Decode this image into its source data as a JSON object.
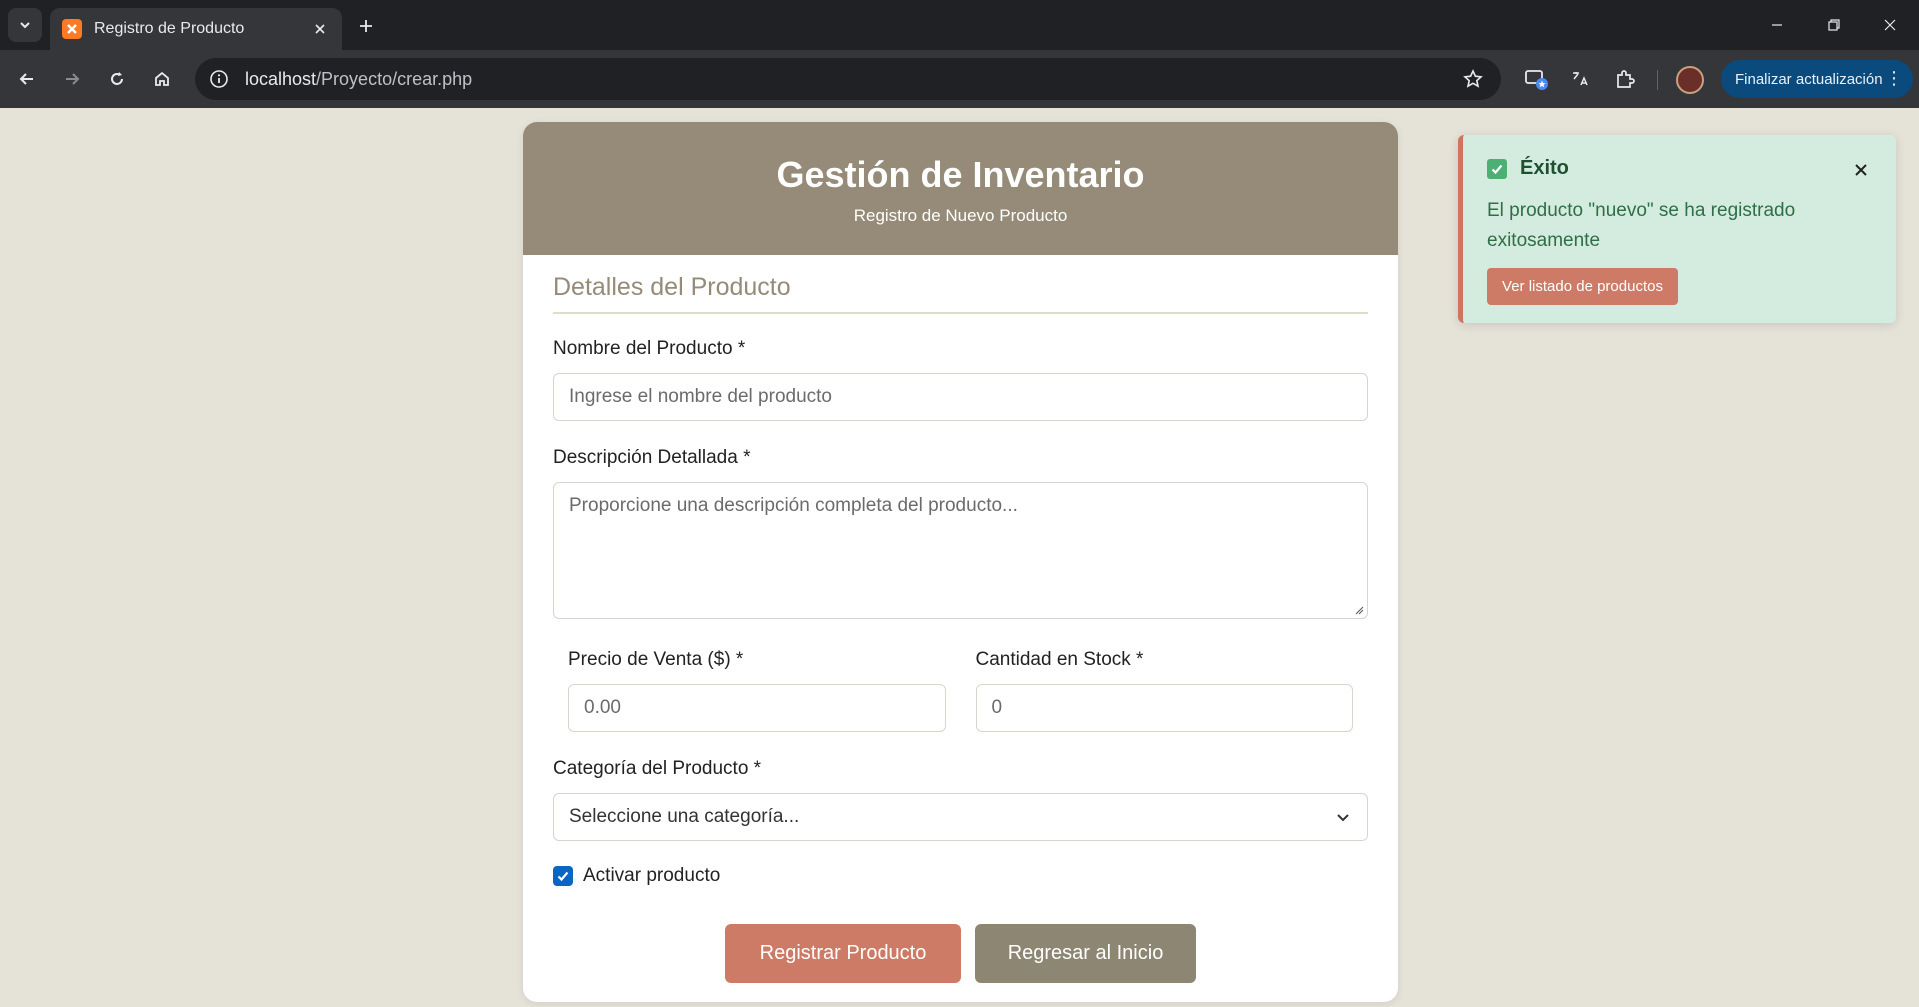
{
  "browser": {
    "tab_title": "Registro de Producto",
    "url_host": "localhost",
    "url_path": "/Proyecto/crear.php",
    "update_button": "Finalizar actualización",
    "update_menu_glyph": "⋮"
  },
  "header": {
    "title": "Gestión de Inventario",
    "subtitle": "Registro de Nuevo Producto"
  },
  "form": {
    "section_title": "Detalles del Producto",
    "name_label": "Nombre del Producto *",
    "name_placeholder": "Ingrese el nombre del producto",
    "description_label": "Descripción Detallada *",
    "description_placeholder": "Proporcione una descripción completa del producto...",
    "price_label": "Precio de Venta ($) *",
    "price_placeholder": "0.00",
    "stock_label": "Cantidad en Stock *",
    "stock_placeholder": "0",
    "category_label": "Categoría del Producto *",
    "category_selected": "Seleccione una categoría...",
    "active_label": "Activar producto",
    "active_checked": true,
    "submit_label": "Registrar Producto",
    "back_label": "Regresar al Inicio"
  },
  "toast": {
    "title": "Éxito",
    "message": "El producto \"nuevo\" se ha registrado exitosamente",
    "action_label": "Ver listado de productos"
  },
  "colors": {
    "page_background": "#e5e2d8",
    "header": "#958b78",
    "primary_button": "#cd7a66",
    "secondary_button": "#8c8672",
    "toast_background": "#d4ecdf",
    "toast_accent": "#d0745f",
    "checkbox": "#0b66c3"
  }
}
